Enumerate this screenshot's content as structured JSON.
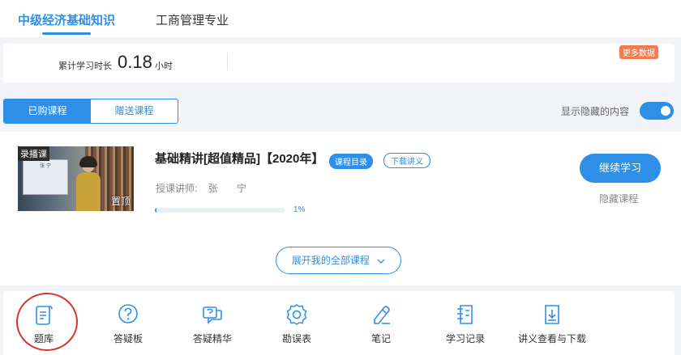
{
  "header": {
    "tabs": [
      {
        "label": "中级经济基础知识",
        "active": true
      },
      {
        "label": "工商管理专业",
        "active": false
      }
    ]
  },
  "stats": {
    "label": "累计学习时长",
    "value": "0.18",
    "unit": "小时",
    "more_label": "更多数据"
  },
  "course_switch": {
    "purchased": "已购课程",
    "gifted": "赠送课程"
  },
  "show_hidden": {
    "label": "显示隐藏的内容",
    "enabled": true
  },
  "course": {
    "thumb_tag": "录播课",
    "thumb_pin": "置顶",
    "thumb_name": "张 宁",
    "title": "基础精讲[超值精品]【2020年】",
    "catalog_label": "课程目录",
    "download_label": "下载讲义",
    "teacher_label": "授课讲师:",
    "teacher_name": "张 宁",
    "progress_text": "1%",
    "progress": 0.01,
    "continue_label": "继续学习",
    "hide_label": "隐藏课程"
  },
  "expand": {
    "label": "展开我的全部课程"
  },
  "tools": [
    {
      "label": "题库",
      "icon": "question-bank-icon"
    },
    {
      "label": "答疑板",
      "icon": "qa-board-icon"
    },
    {
      "label": "答疑精华",
      "icon": "qa-essence-icon"
    },
    {
      "label": "勘误表",
      "icon": "errata-icon"
    },
    {
      "label": "笔记",
      "icon": "notes-icon"
    },
    {
      "label": "学习记录",
      "icon": "study-record-icon"
    },
    {
      "label": "讲义查看与下载",
      "icon": "handout-download-icon"
    }
  ],
  "colors": {
    "accent": "#2e8fe8",
    "badge": "#f37b4e",
    "highlight": "#d9342b"
  }
}
